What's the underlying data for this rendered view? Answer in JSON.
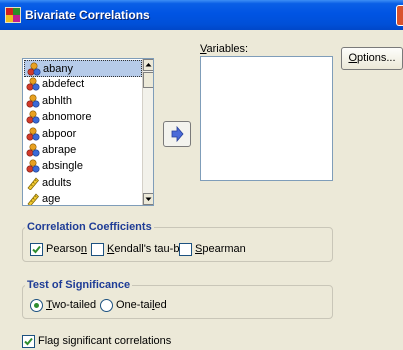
{
  "window": {
    "title": "Bivariate Correlations",
    "icon": "spss-dialog-icon"
  },
  "variables_list": {
    "items": [
      {
        "label": "abany",
        "icon": "nominal-variable-icon",
        "selected": true
      },
      {
        "label": "abdefect",
        "icon": "nominal-variable-icon",
        "selected": false
      },
      {
        "label": "abhlth",
        "icon": "nominal-variable-icon",
        "selected": false
      },
      {
        "label": "abnomore",
        "icon": "nominal-variable-icon",
        "selected": false
      },
      {
        "label": "abpoor",
        "icon": "nominal-variable-icon",
        "selected": false
      },
      {
        "label": "abrape",
        "icon": "nominal-variable-icon",
        "selected": false
      },
      {
        "label": "absingle",
        "icon": "nominal-variable-icon",
        "selected": false
      },
      {
        "label": "adults",
        "icon": "scale-variable-icon",
        "selected": false
      },
      {
        "label": "age",
        "icon": "scale-variable-icon",
        "selected": false
      }
    ]
  },
  "target": {
    "label_prefix": "V",
    "label_rest": "ariables:"
  },
  "options_button": {
    "label_prefix": "O",
    "label_rest": "ptions..."
  },
  "correlation_coefficients": {
    "title": "Correlation Coefficients",
    "pearson": {
      "pre": "Pearso",
      "ul": "n",
      "post": "",
      "checked": true
    },
    "kendall": {
      "pre": "",
      "ul": "K",
      "post": "endall's tau-b",
      "checked": false
    },
    "spearman": {
      "pre": "",
      "ul": "S",
      "post": "pearman",
      "checked": false
    }
  },
  "test_of_significance": {
    "title": "Test of Significance",
    "two_tailed": {
      "pre": "",
      "ul": "T",
      "post": "wo-tailed",
      "selected": true
    },
    "one_tailed": {
      "pre": "One-tai",
      "ul": "l",
      "post": "ed",
      "selected": false
    }
  },
  "flag": {
    "label": "Flag significant correlations",
    "checked": true
  },
  "colors": {
    "title_bar": "#0054e3",
    "group_title": "#1e3c96",
    "selection": "#b6cbe9",
    "check": "#2f8d2f"
  }
}
